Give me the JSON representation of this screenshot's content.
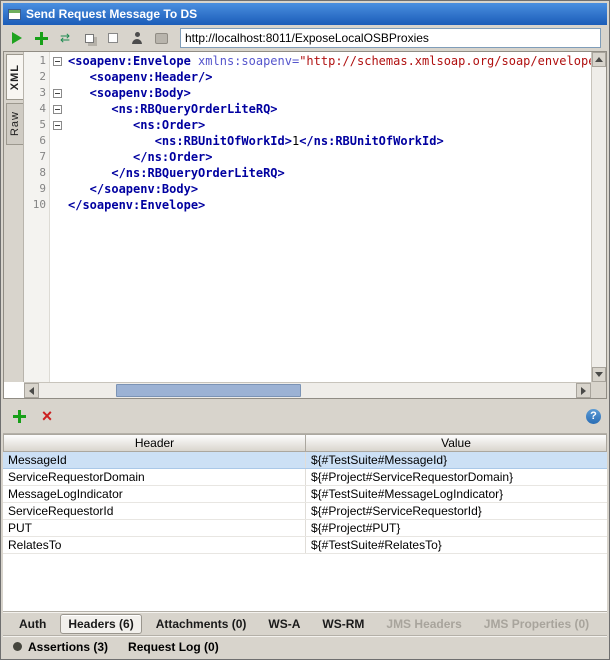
{
  "window": {
    "title": "Send Request Message To DS"
  },
  "toolbar": {
    "url": "http://localhost:8011/ExposeLocalOSBProxies",
    "icons": [
      {
        "name": "submit-request-button"
      },
      {
        "name": "add-to-testcase-button"
      },
      {
        "name": "add-to-mockservice-button"
      },
      {
        "name": "clone-request-button"
      },
      {
        "name": "cancel-request-button"
      },
      {
        "name": "auth-button"
      },
      {
        "name": "settings-button"
      }
    ]
  },
  "editor": {
    "side_tabs": [
      {
        "label": "XML",
        "selected": true
      },
      {
        "label": "Raw",
        "selected": false
      }
    ],
    "lines": [
      {
        "num": "1",
        "fold": true,
        "segs": [
          [
            "tag",
            "<soapenv:Envelope "
          ],
          [
            "attr",
            "xmlns:soapenv="
          ],
          [
            "str",
            "\"http://schemas.xmlsoap.org/soap/envelope/\""
          ]
        ]
      },
      {
        "num": "2",
        "fold": false,
        "segs": [
          [
            "tag",
            "   <soapenv:Header/>"
          ]
        ]
      },
      {
        "num": "3",
        "fold": true,
        "segs": [
          [
            "tag",
            "   <soapenv:Body>"
          ]
        ]
      },
      {
        "num": "4",
        "fold": true,
        "segs": [
          [
            "tag",
            "      <ns:RBQueryOrderLiteRQ>"
          ]
        ]
      },
      {
        "num": "5",
        "fold": true,
        "segs": [
          [
            "tag",
            "         <ns:Order>"
          ]
        ]
      },
      {
        "num": "6",
        "fold": false,
        "segs": [
          [
            "tag",
            "            <ns:RBUnitOfWorkId>"
          ],
          [
            "txt",
            "1"
          ],
          [
            "tag",
            "</ns:RBUnitOfWorkId>"
          ]
        ]
      },
      {
        "num": "7",
        "fold": false,
        "segs": [
          [
            "tag",
            "         </ns:Order>"
          ]
        ]
      },
      {
        "num": "8",
        "fold": false,
        "segs": [
          [
            "tag",
            "      </ns:RBQueryOrderLiteRQ>"
          ]
        ]
      },
      {
        "num": "9",
        "fold": false,
        "segs": [
          [
            "tag",
            "   </soapenv:Body>"
          ]
        ]
      },
      {
        "num": "10",
        "fold": false,
        "segs": [
          [
            "tag",
            "</soapenv:Envelope>"
          ]
        ]
      }
    ]
  },
  "headers_toolbar": {
    "help": "?",
    "icons": [
      {
        "name": "add-header-button"
      },
      {
        "name": "remove-header-button"
      },
      {
        "name": "help-button"
      }
    ]
  },
  "headers_table": {
    "columns": [
      "Header",
      "Value"
    ],
    "rows": [
      {
        "header": "MessageId",
        "value": "${#TestSuite#MessageId}",
        "selected": true
      },
      {
        "header": "ServiceRequestorDomain",
        "value": "${#Project#ServiceRequestorDomain}",
        "selected": false
      },
      {
        "header": "MessageLogIndicator",
        "value": "${#TestSuite#MessageLogIndicator}",
        "selected": false
      },
      {
        "header": "ServiceRequestorId",
        "value": "${#Project#ServiceRequestorId}",
        "selected": false
      },
      {
        "header": "PUT",
        "value": "${#Project#PUT}",
        "selected": false
      },
      {
        "header": "RelatesTo",
        "value": "${#TestSuite#RelatesTo}",
        "selected": false
      }
    ]
  },
  "bottom_tabs": [
    {
      "label": "Auth",
      "state": "normal"
    },
    {
      "label": "Headers (6)",
      "state": "selected"
    },
    {
      "label": "Attachments (0)",
      "state": "normal"
    },
    {
      "label": "WS-A",
      "state": "normal"
    },
    {
      "label": "WS-RM",
      "state": "normal"
    },
    {
      "label": "JMS Headers",
      "state": "disabled"
    },
    {
      "label": "JMS Properties (0)",
      "state": "disabled"
    }
  ],
  "footer": {
    "assertions": "Assertions (3)",
    "request_log": "Request Log (0)"
  },
  "colors": {
    "titlebar_top": "#4a8fe0",
    "titlebar_bottom": "#1b5cb8",
    "selection": "#cce0f5",
    "xml_tag": "#0000a0",
    "xml_attr": "#5555cc",
    "xml_string": "#b01010",
    "accent_green": "#18a018",
    "accent_red": "#cc2020"
  }
}
